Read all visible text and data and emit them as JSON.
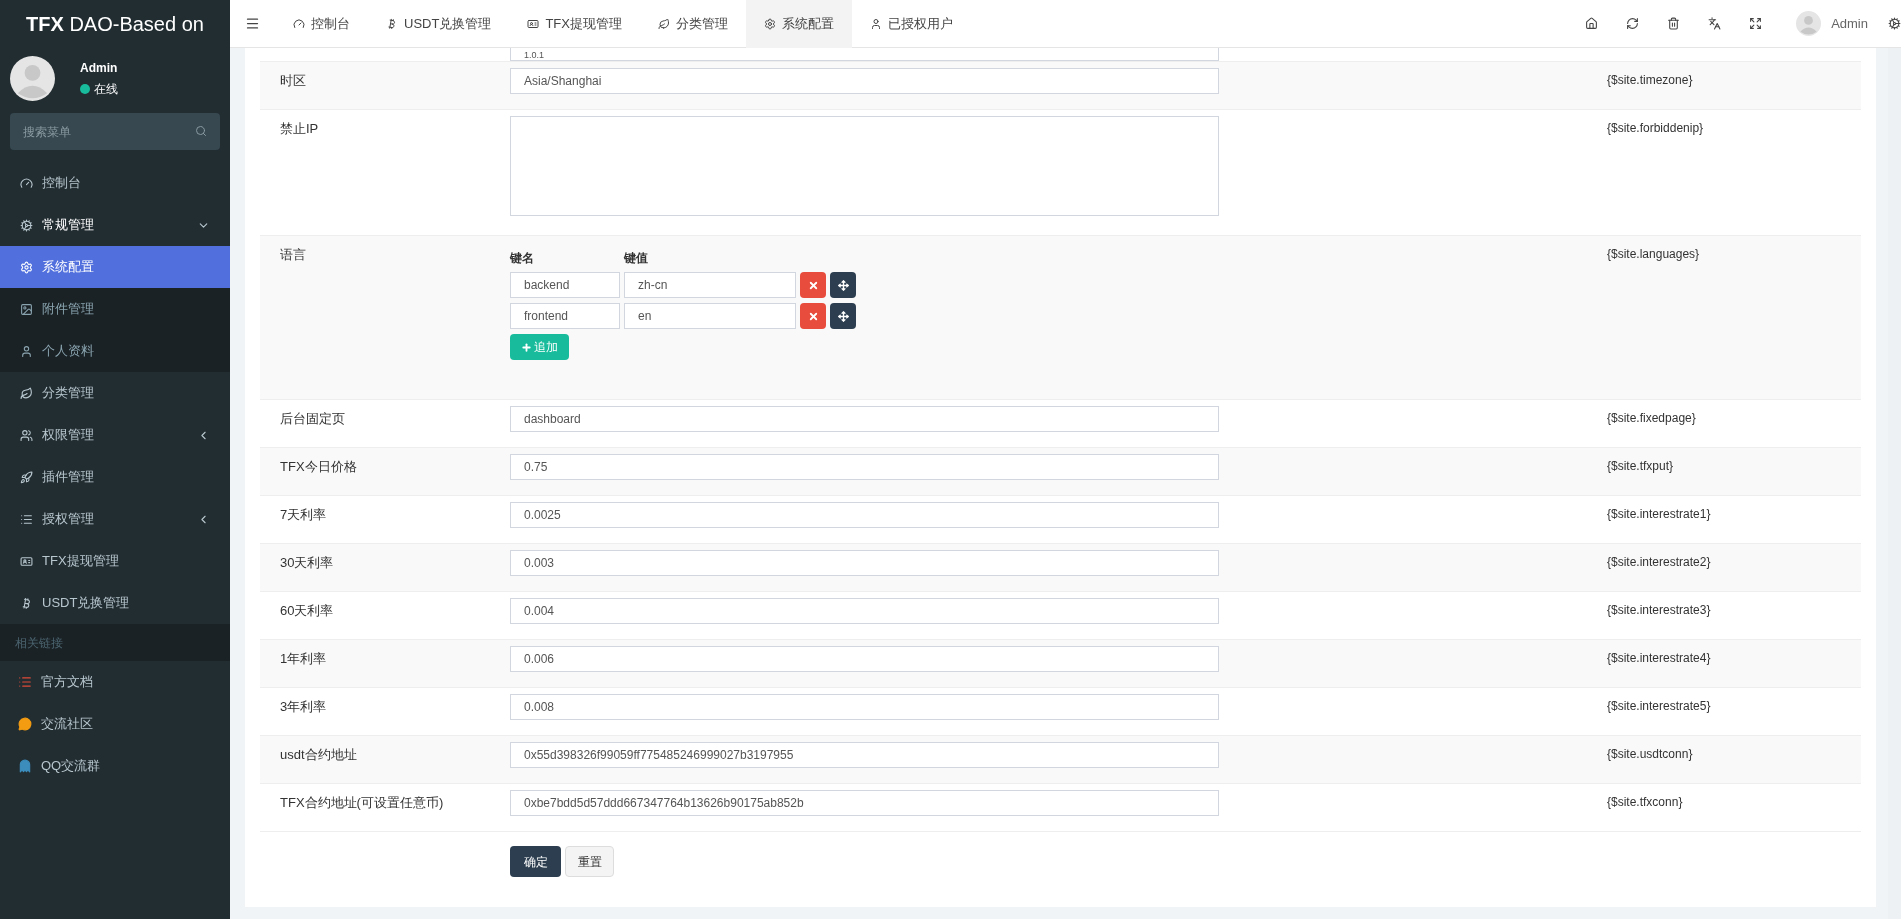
{
  "sidebar": {
    "brand_bold": "TFX",
    "brand": "DAO-Based on",
    "user": {
      "name": "Admin",
      "status": "在线",
      "online": true
    },
    "search": {
      "placeholder": "搜索菜单"
    },
    "menu": [
      {
        "label": "控制台",
        "selected": false
      },
      {
        "label": "常规管理",
        "selected": false,
        "expanded": true,
        "children": [
          {
            "label": "系统配置",
            "selected": true
          },
          {
            "label": "附件管理",
            "selected": false
          },
          {
            "label": "个人资料",
            "selected": false
          }
        ]
      },
      {
        "label": "分类管理",
        "selected": false
      },
      {
        "label": "权限管理",
        "selected": false,
        "expanded": false
      },
      {
        "label": "插件管理",
        "selected": false
      },
      {
        "label": "授权管理",
        "selected": false,
        "expanded": false
      },
      {
        "label": "TFX提现管理",
        "selected": false
      },
      {
        "label": "USDT兑换管理",
        "selected": false
      }
    ],
    "section": "相关链接",
    "links": [
      {
        "label": "官方文档"
      },
      {
        "label": "交流社区"
      },
      {
        "label": "QQ交流群"
      }
    ]
  },
  "tabs": [
    {
      "label": "控制台",
      "selected": false
    },
    {
      "label": "USDT兑换管理",
      "selected": false
    },
    {
      "label": "TFX提现管理",
      "selected": false
    },
    {
      "label": "分类管理",
      "selected": false
    },
    {
      "label": "系统配置",
      "selected": true
    },
    {
      "label": "已授权用户",
      "selected": false
    }
  ],
  "header_user": "Admin",
  "form": {
    "rows": [
      {
        "kind": "cut",
        "value": "1.0.1"
      },
      {
        "kind": "input",
        "label": "时区",
        "value": "Asia/Shanghai",
        "key": "{$site.timezone}"
      },
      {
        "kind": "textarea",
        "label": "禁止IP",
        "key": "{$site.forbiddenip}"
      },
      {
        "kind": "keyvalue",
        "label": "语言",
        "key": "{$site.languages}",
        "key_header": "键名",
        "value_header": "键值",
        "pairs": [
          {
            "name": "backend",
            "value": "zh-cn"
          },
          {
            "name": "frontend",
            "value": "en"
          }
        ],
        "add_label": "追加"
      },
      {
        "kind": "input",
        "label": "后台固定页",
        "value": "dashboard",
        "key": "{$site.fixedpage}"
      },
      {
        "kind": "input",
        "label": "TFX今日价格",
        "value": "0.75",
        "key": "{$site.tfxput}"
      },
      {
        "kind": "input",
        "label": "7天利率",
        "value": "0.0025",
        "key": "{$site.interestrate1}"
      },
      {
        "kind": "input",
        "label": "30天利率",
        "value": "0.003",
        "key": "{$site.interestrate2}"
      },
      {
        "kind": "input",
        "label": "60天利率",
        "value": "0.004",
        "key": "{$site.interestrate3}"
      },
      {
        "kind": "input",
        "label": "1年利率",
        "value": "0.006",
        "key": "{$site.interestrate4}"
      },
      {
        "kind": "input",
        "label": "3年利率",
        "value": "0.008",
        "key": "{$site.interestrate5}"
      },
      {
        "kind": "input",
        "label": "usdt合约地址",
        "value": "0x55d398326f99059ff775485246999027b3197955",
        "key": "{$site.usdtconn}"
      },
      {
        "kind": "input",
        "label": "TFX合约地址(可设置任意币)",
        "value": "0xbe7bdd5d57ddd667347764b13626b90175ab852b",
        "key": "{$site.tfxconn}"
      }
    ],
    "submit": "确定",
    "reset": "重置"
  }
}
